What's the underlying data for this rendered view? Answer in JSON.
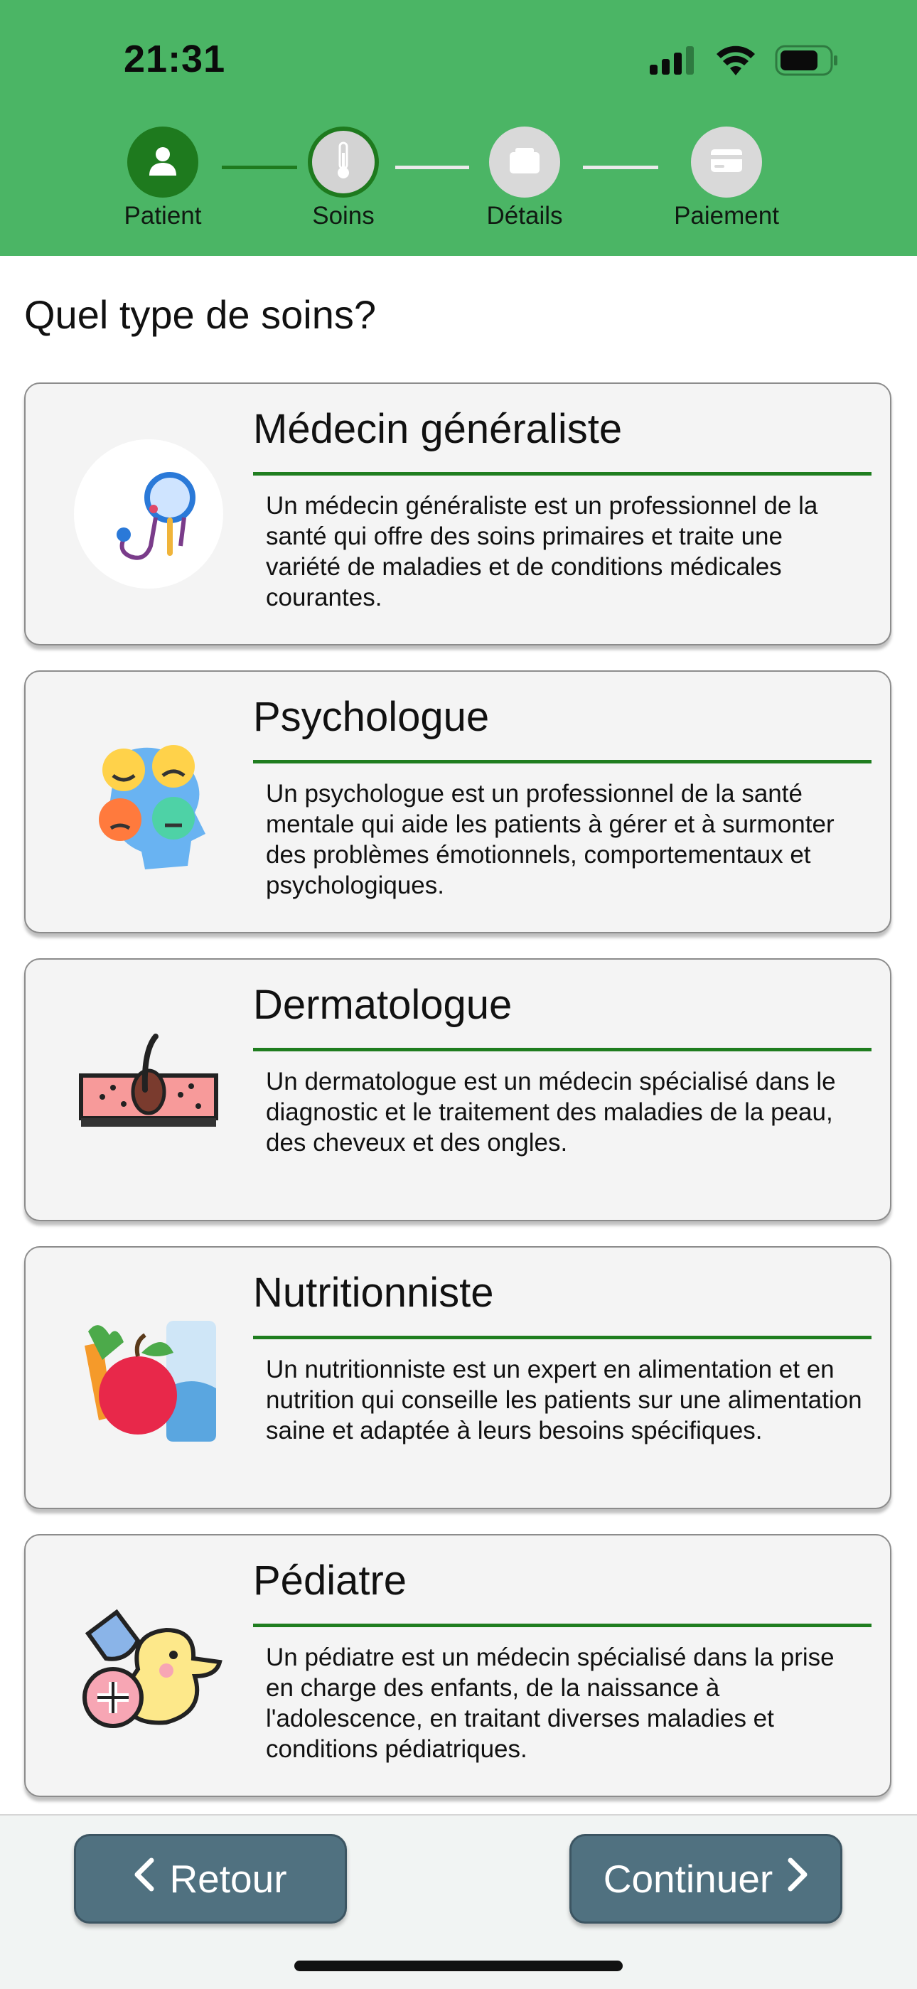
{
  "status_bar": {
    "time": "21:31"
  },
  "stepper": {
    "steps": [
      {
        "label": "Patient",
        "state": "completed",
        "icon": "person-icon"
      },
      {
        "label": "Soins",
        "state": "active",
        "icon": "thermometer-icon"
      },
      {
        "label": "Détails",
        "state": "pending",
        "icon": "box-icon"
      },
      {
        "label": "Paiement",
        "state": "pending",
        "icon": "card-icon"
      }
    ]
  },
  "main": {
    "title": "Quel type de soins?",
    "cards": [
      {
        "title": "Médecin généraliste",
        "description": "Un médecin généraliste est un professionnel de la santé qui offre des soins primaires et traite une variété de maladies et de conditions médicales courantes.",
        "icon": "stethoscope-icon"
      },
      {
        "title": "Psychologue",
        "description": "Un psychologue est un professionnel de la santé mentale qui aide les patients à gérer et à surmonter des problèmes émotionnels, comportementaux et psychologiques.",
        "icon": "emotions-head-icon"
      },
      {
        "title": "Dermatologue",
        "description": "Un dermatologue est un médecin spécialisé dans le diagnostic et le traitement des maladies de la peau, des cheveux et des ongles.",
        "icon": "skin-hair-icon"
      },
      {
        "title": "Nutritionniste",
        "description": "Un nutritionniste est un expert en alimentation et en nutrition qui conseille les patients sur une alimentation saine et adaptée à leurs besoins spécifiques.",
        "icon": "food-icon"
      },
      {
        "title": "Pédiatre",
        "description": "Un pédiatre est un médecin spécialisé dans la prise en charge des enfants, de la naissance à l'adolescence, en traitant diverses maladies et conditions pédiatriques.",
        "icon": "rubber-duck-icon"
      }
    ]
  },
  "footer": {
    "back_label": "Retour",
    "continue_label": "Continuer"
  },
  "colors": {
    "header_green": "#4bb565",
    "step_active": "#1e7a1e",
    "step_pending": "#d9d9d9",
    "button": "#507180",
    "rule": "#1f7d1f"
  }
}
